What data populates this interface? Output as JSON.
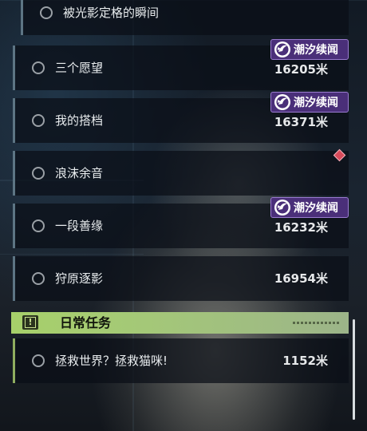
{
  "quests": [
    {
      "title": "被光影定格的瞬间",
      "distance": "",
      "badge": "",
      "marker": false
    },
    {
      "title": "三个愿望",
      "distance": "16205米",
      "badge": "潮汐续闻",
      "marker": false
    },
    {
      "title": "我的搭档",
      "distance": "16371米",
      "badge": "潮汐续闻",
      "marker": false
    },
    {
      "title": "浪沫余音",
      "distance": "",
      "badge": "",
      "marker": true
    },
    {
      "title": "一段善缘",
      "distance": "16232米",
      "badge": "潮汐续闻",
      "marker": false
    },
    {
      "title": "狩原逐影",
      "distance": "16954米",
      "badge": "",
      "marker": false
    }
  ],
  "daily_section": {
    "title": "日常任务",
    "icon": "exclamation-icon",
    "accent_color": "#a7d06a",
    "quests": [
      {
        "title": "拯救世界？拯救猫咪!",
        "distance": "1152米"
      }
    ]
  },
  "colors": {
    "badge_bg": "#4a2f79",
    "row_bar": "#5d7584",
    "daily_bar": "#8fae5f",
    "marker": "#d64a5a"
  }
}
